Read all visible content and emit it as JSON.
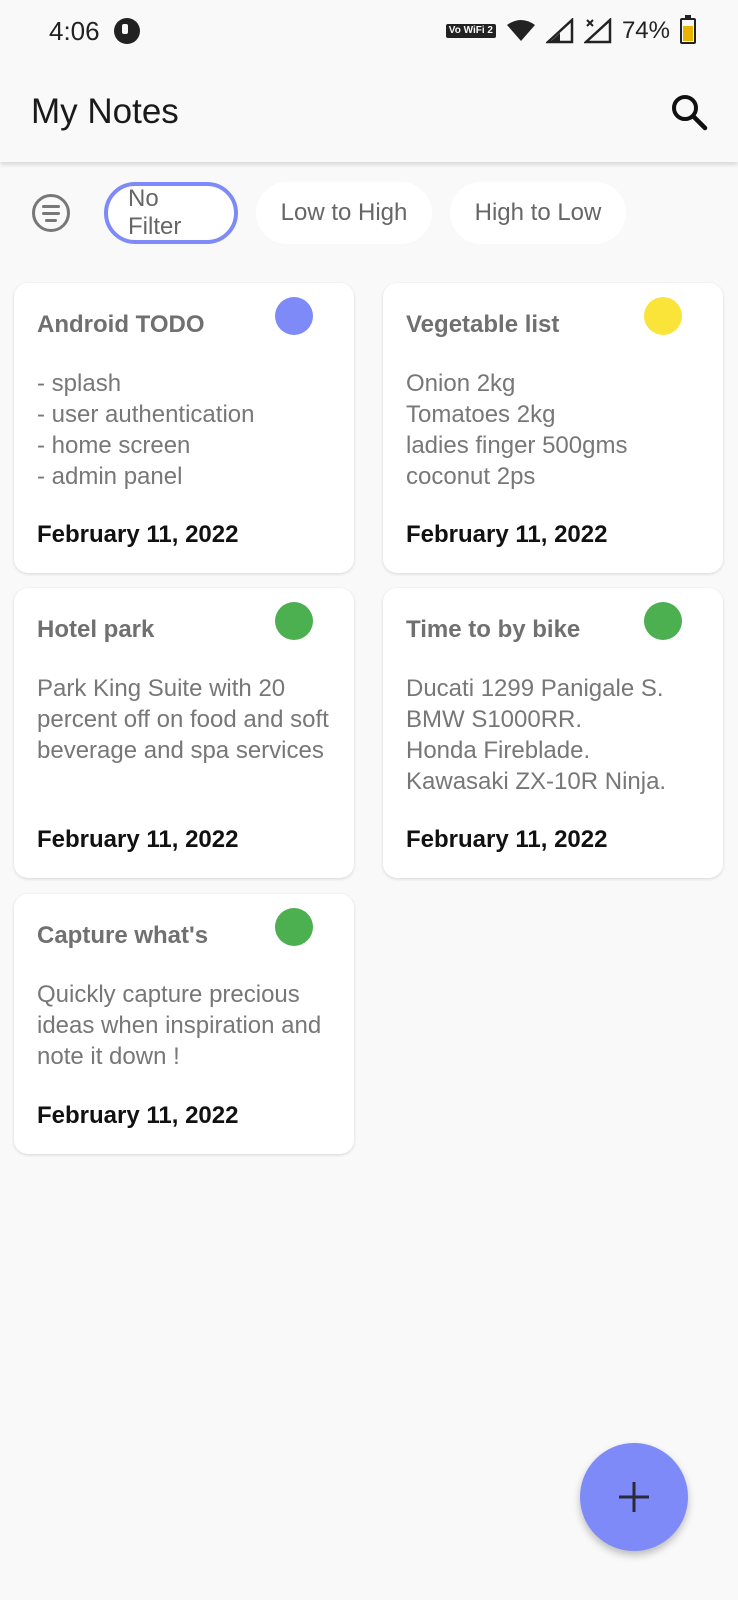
{
  "status_bar": {
    "time": "4:06",
    "battery": "74%",
    "vowifi": "Vo WiFi 2"
  },
  "app_bar": {
    "title": "My Notes"
  },
  "filters": [
    "No Filter",
    "Low to High",
    "High to Low"
  ],
  "notes": [
    {
      "title": "Android TODO",
      "color": "#7d8af8",
      "body": "- splash\n- user authentication\n- home screen\n- admin panel",
      "date": "February 11, 2022"
    },
    {
      "title": "Vegetable list",
      "color": "#fbe43a",
      "body": "Onion 2kg\nTomatoes 2kg\nladies finger 500gms\ncoconut 2ps",
      "date": "February 11, 2022"
    },
    {
      "title": "Hotel park",
      "color": "#4caf50",
      "body": "Park King Suite with 20 percent off on food and soft beverage and spa services",
      "date": "February 11, 2022"
    },
    {
      "title": "Time to by bike",
      "color": "#4caf50",
      "body": "Ducati 1299 Panigale S.\nBMW S1000RR.\nHonda Fireblade.\nKawasaki ZX-10R Ninja.",
      "date": "February 11, 2022"
    },
    {
      "title": "Capture what's",
      "color": "#4caf50",
      "body": "Quickly capture precious ideas when inspiration and note it down !",
      "date": "February 11, 2022"
    }
  ],
  "icons": {
    "search": "search-icon",
    "filter": "filter-list-icon",
    "add": "plus-icon"
  },
  "colors": {
    "accent": "#7d8af8"
  }
}
